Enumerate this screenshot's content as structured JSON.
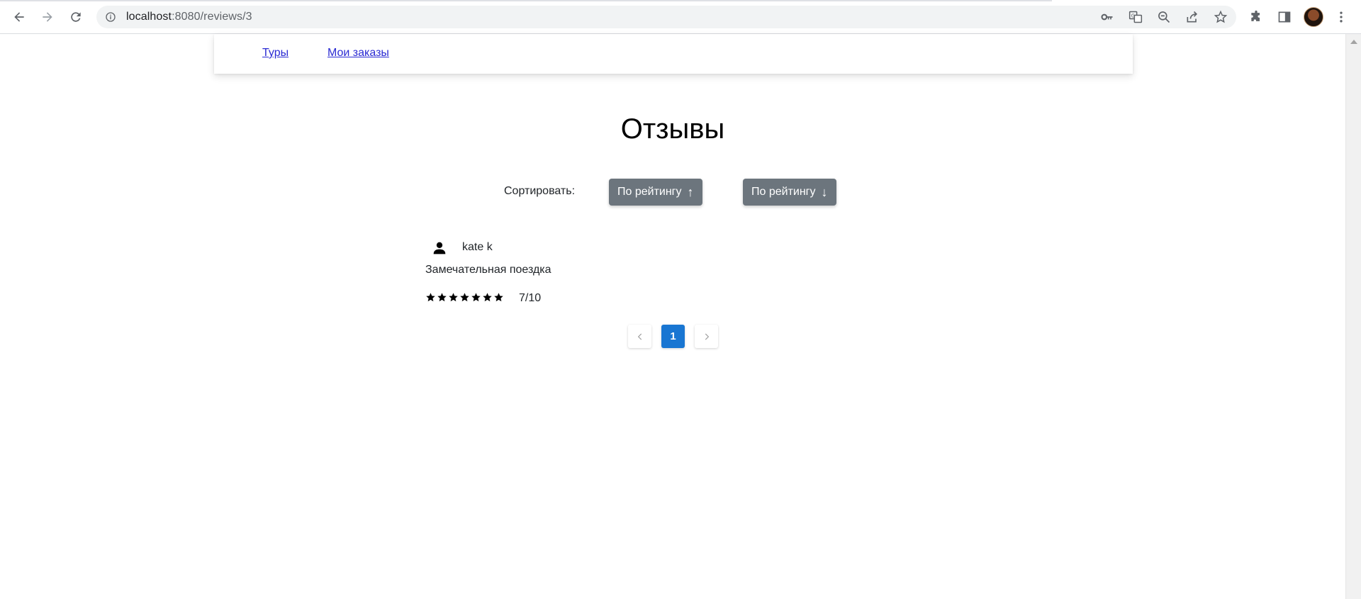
{
  "browser": {
    "url_host": "localhost",
    "url_path": ":8080/reviews/3"
  },
  "nav": {
    "tours": "Туры",
    "my_orders": "Мои заказы"
  },
  "page": {
    "title": "Отзывы",
    "sort_label": "Сортировать:",
    "sort_asc": "По рейтингу",
    "sort_desc": "По рейтингу",
    "sort_asc_arrow": "↑",
    "sort_desc_arrow": "↓"
  },
  "reviews": [
    {
      "author": "kate k",
      "text": "Замечательная поездка",
      "stars": 7,
      "rating": "7/10"
    }
  ],
  "pagination": {
    "current": "1"
  },
  "colors": {
    "sort_button": "#6c757d",
    "page_active": "#1976d2"
  }
}
